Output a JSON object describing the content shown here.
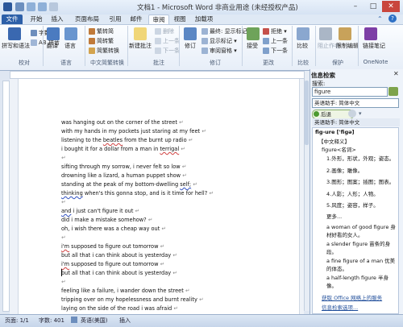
{
  "window": {
    "title": "文档1 - Microsoft Word 非商业用途 (未经授权产品)",
    "controls": [
      "minimize-icon",
      "maximize-icon",
      "close-icon"
    ]
  },
  "tabs": [
    "文件",
    "开始",
    "插入",
    "页面布局",
    "引用",
    "邮件",
    "审阅",
    "视图",
    "加载项"
  ],
  "ribbon": {
    "groups": {
      "proofing": {
        "label": "校对",
        "big": "拼写和语法",
        "small": [
          "字数",
          "AB 拼音"
        ]
      },
      "language": {
        "label": "语言",
        "big": [
          "翻译",
          "语言"
        ]
      },
      "chinese": {
        "label": "中文简繁转换",
        "items": [
          "繁转简",
          "简转繁",
          "简繁转换"
        ]
      },
      "comments": {
        "label": "批注",
        "big": "新建批注",
        "items": [
          "删除",
          "上一条",
          "下一条"
        ]
      },
      "tracking": {
        "label": "修订",
        "big": "修订",
        "items": [
          "最终: 显示标记",
          "显示标记 ▾",
          "审阅窗格 ▾"
        ]
      },
      "changes": {
        "label": "更改",
        "big": "接受",
        "items": [
          "拒绝 ▾",
          "上一条",
          "下一条"
        ]
      },
      "compare": {
        "label": "比较",
        "big": "比较"
      },
      "protect": {
        "label": "保护",
        "big": [
          "阻止作者",
          "限制编辑"
        ]
      },
      "onenote": {
        "label": "OneNote",
        "big": "链接笔记"
      }
    }
  },
  "document": {
    "lines": [
      {
        "text": "was hanging out on the corner of the street"
      },
      {
        "text": "with my hands in my pockets just staring at my feet"
      },
      {
        "text": "listening to the ",
        "mark": "beatles",
        "after": " from the burnt up radio"
      },
      {
        "text": "i bought it for a dollar from a man in ",
        "mark": "terrigal",
        "after": ""
      },
      {
        "text": ""
      },
      {
        "text": "sifting through my sorrow, i never felt so low"
      },
      {
        "text": "drowning like a lizard, a human puppet show"
      },
      {
        "text": "standing at the peak of my bottom-dwelling ",
        "markb": "self;",
        "after": ""
      },
      {
        "text": "",
        "markb": "thinking",
        "after": " when's this gonna stop, and is it time for hell?"
      },
      {
        "text": ""
      },
      {
        "text": "",
        "markb": "and",
        "after": " i just can't figure it out"
      },
      {
        "text": "did i make a mistake somehow?"
      },
      {
        "text": "oh, i wish there was a cheap way out"
      },
      {
        "text": ""
      },
      {
        "text": "",
        "mark": "i'm",
        "after": " supposed to figure out tomorrow"
      },
      {
        "text": "but all that i can think about is yesterday"
      },
      {
        "text": "",
        "mark": "i'm",
        "after": " supposed to figure out tomorrow"
      },
      {
        "text": "but all that i can think about is yesterday"
      },
      {
        "text": ""
      },
      {
        "text": "feeling like a failure, i wander down the street"
      },
      {
        "text": "tripping over on my hopelessness and burnt reality"
      },
      {
        "text": "laying on the side of the road i was afraid"
      }
    ]
  },
  "pane": {
    "title": "信息检索",
    "search_label": "搜索:",
    "search_value": "figure",
    "source": "英语助手: 简体中文",
    "back": "后退",
    "result_header": "英语助手: 简体中文",
    "word": "fig-ure ['figə]",
    "section": "【中文释义】",
    "pos": "figure<名词>",
    "senses": [
      "1.外形，形状，外观；姿态。",
      "2.画像；雕像。",
      "3.图形；图案；插图；图表。",
      "4.人影；人形；人物。",
      "5.风度；姿容，样子。"
    ],
    "more": "更多...",
    "examples": [
      "a woman of good figure 身材好看的女人。",
      "a slender figure 苗条的身段。",
      "a fine figure of a man 优美的体态。",
      "a half-length figure 半身像。"
    ],
    "bottom_links": [
      "获取 Office 网络上的服务",
      "信息检索选项..."
    ]
  },
  "status": {
    "page": "页面: 1/1",
    "words": "字数: 401",
    "language": "英语(美国)",
    "mode": "插入"
  },
  "colors": {
    "accent": "#2c5fa8",
    "ribbon_bg": "#e7eef8",
    "doc_bg": "#ffffff"
  }
}
